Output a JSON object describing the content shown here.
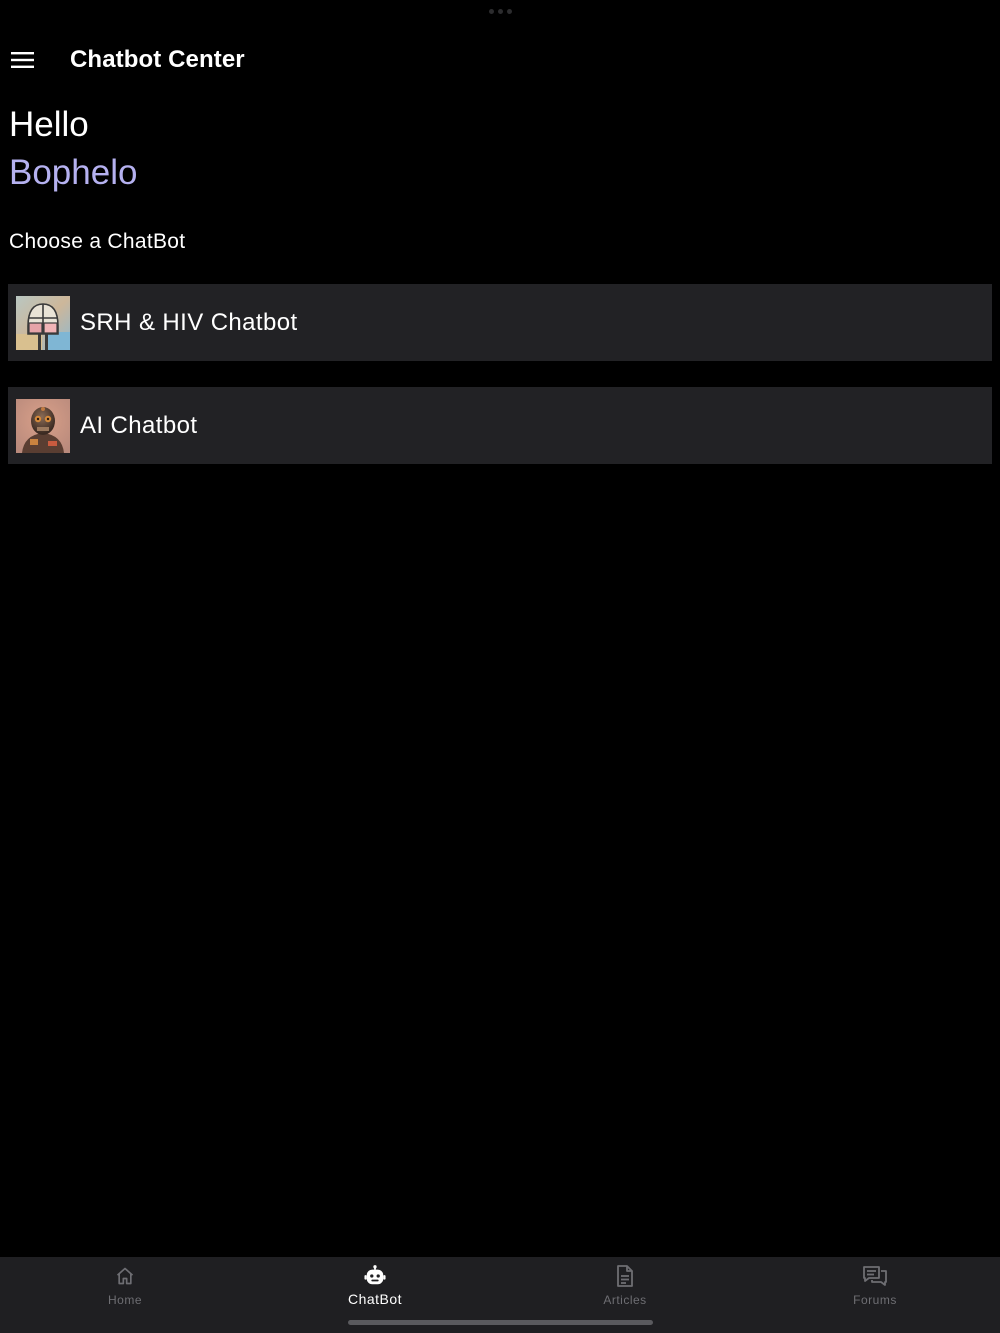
{
  "header": {
    "title": "Chatbot Center"
  },
  "greeting": {
    "hello": "Hello",
    "name": "Bophelo"
  },
  "section": {
    "label": "Choose a ChatBot"
  },
  "chatbots": [
    {
      "label": "SRH & HIV Chatbot",
      "avatar_icon": "srh-hiv-chatbot-avatar"
    },
    {
      "label": "AI Chatbot",
      "avatar_icon": "ai-chatbot-avatar"
    }
  ],
  "tabs": [
    {
      "label": "Home",
      "icon": "home-icon",
      "active": false
    },
    {
      "label": "ChatBot",
      "icon": "robot-icon",
      "active": true
    },
    {
      "label": "Articles",
      "icon": "document-icon",
      "active": false
    },
    {
      "label": "Forums",
      "icon": "chat-bubbles-icon",
      "active": false
    }
  ],
  "colors": {
    "background": "#000000",
    "card": "#222225",
    "accent_name": "#b5b1f0",
    "tabbar": "#1f1f22",
    "inactive_tab": "#6e6e73"
  }
}
